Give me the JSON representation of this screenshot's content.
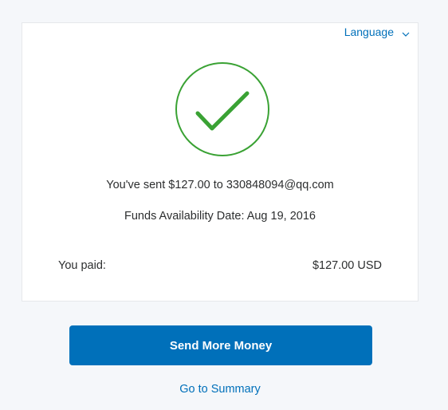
{
  "language": {
    "label": "Language",
    "icon": "chevron-down-icon"
  },
  "confirmation": {
    "success_icon": "checkmark-circle-icon",
    "sent_message": "You've sent $127.00 to 330848094@qq.com",
    "funds_availability": "Funds Availability Date: Aug 19, 2016"
  },
  "payment": {
    "label": "You paid:",
    "amount": "$127.00 USD"
  },
  "actions": {
    "send_more_label": "Send More Money",
    "summary_link": "Go to Summary"
  },
  "colors": {
    "accent": "#0070ba",
    "success": "#3aa234",
    "background": "#f5f7fa"
  }
}
